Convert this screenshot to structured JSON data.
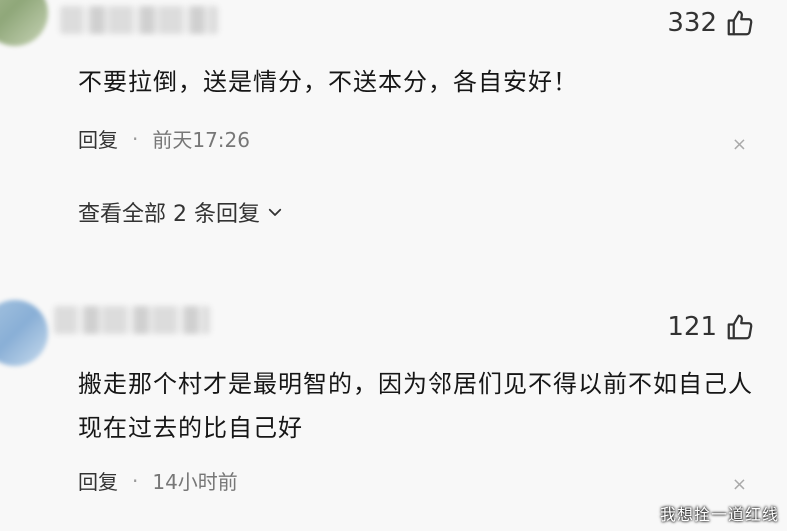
{
  "comments": [
    {
      "likes": "332",
      "text": "不要拉倒，送是情分，不送本分，各自安好！",
      "reply_label": "回复",
      "separator": "·",
      "time": "前天17:26",
      "close_glyph": "×",
      "view_replies": "查看全部 2 条回复"
    },
    {
      "likes": "121",
      "text": "搬走那个村才是最明智的，因为邻居们见不得以前不如自己人现在过去的比自己好",
      "reply_label": "回复",
      "separator": "·",
      "time": "14小时前",
      "close_glyph": "×"
    }
  ],
  "watermark": "我想拴一道红线"
}
